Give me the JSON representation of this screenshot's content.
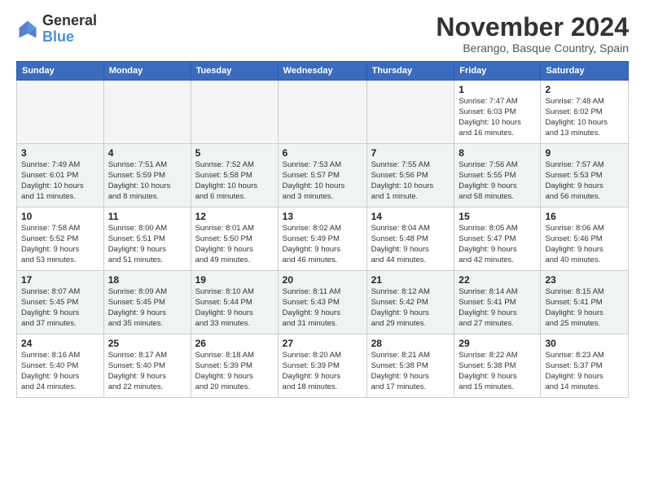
{
  "logo": {
    "line1": "General",
    "line2": "Blue"
  },
  "title": "November 2024",
  "location": "Berango, Basque Country, Spain",
  "weekdays": [
    "Sunday",
    "Monday",
    "Tuesday",
    "Wednesday",
    "Thursday",
    "Friday",
    "Saturday"
  ],
  "weeks": [
    [
      {
        "day": "",
        "info": ""
      },
      {
        "day": "",
        "info": ""
      },
      {
        "day": "",
        "info": ""
      },
      {
        "day": "",
        "info": ""
      },
      {
        "day": "",
        "info": ""
      },
      {
        "day": "1",
        "info": "Sunrise: 7:47 AM\nSunset: 6:03 PM\nDaylight: 10 hours\nand 16 minutes."
      },
      {
        "day": "2",
        "info": "Sunrise: 7:48 AM\nSunset: 6:02 PM\nDaylight: 10 hours\nand 13 minutes."
      }
    ],
    [
      {
        "day": "3",
        "info": "Sunrise: 7:49 AM\nSunset: 6:01 PM\nDaylight: 10 hours\nand 11 minutes."
      },
      {
        "day": "4",
        "info": "Sunrise: 7:51 AM\nSunset: 5:59 PM\nDaylight: 10 hours\nand 8 minutes."
      },
      {
        "day": "5",
        "info": "Sunrise: 7:52 AM\nSunset: 5:58 PM\nDaylight: 10 hours\nand 6 minutes."
      },
      {
        "day": "6",
        "info": "Sunrise: 7:53 AM\nSunset: 5:57 PM\nDaylight: 10 hours\nand 3 minutes."
      },
      {
        "day": "7",
        "info": "Sunrise: 7:55 AM\nSunset: 5:56 PM\nDaylight: 10 hours\nand 1 minute."
      },
      {
        "day": "8",
        "info": "Sunrise: 7:56 AM\nSunset: 5:55 PM\nDaylight: 9 hours\nand 58 minutes."
      },
      {
        "day": "9",
        "info": "Sunrise: 7:57 AM\nSunset: 5:53 PM\nDaylight: 9 hours\nand 56 minutes."
      }
    ],
    [
      {
        "day": "10",
        "info": "Sunrise: 7:58 AM\nSunset: 5:52 PM\nDaylight: 9 hours\nand 53 minutes."
      },
      {
        "day": "11",
        "info": "Sunrise: 8:00 AM\nSunset: 5:51 PM\nDaylight: 9 hours\nand 51 minutes."
      },
      {
        "day": "12",
        "info": "Sunrise: 8:01 AM\nSunset: 5:50 PM\nDaylight: 9 hours\nand 49 minutes."
      },
      {
        "day": "13",
        "info": "Sunrise: 8:02 AM\nSunset: 5:49 PM\nDaylight: 9 hours\nand 46 minutes."
      },
      {
        "day": "14",
        "info": "Sunrise: 8:04 AM\nSunset: 5:48 PM\nDaylight: 9 hours\nand 44 minutes."
      },
      {
        "day": "15",
        "info": "Sunrise: 8:05 AM\nSunset: 5:47 PM\nDaylight: 9 hours\nand 42 minutes."
      },
      {
        "day": "16",
        "info": "Sunrise: 8:06 AM\nSunset: 5:46 PM\nDaylight: 9 hours\nand 40 minutes."
      }
    ],
    [
      {
        "day": "17",
        "info": "Sunrise: 8:07 AM\nSunset: 5:45 PM\nDaylight: 9 hours\nand 37 minutes."
      },
      {
        "day": "18",
        "info": "Sunrise: 8:09 AM\nSunset: 5:45 PM\nDaylight: 9 hours\nand 35 minutes."
      },
      {
        "day": "19",
        "info": "Sunrise: 8:10 AM\nSunset: 5:44 PM\nDaylight: 9 hours\nand 33 minutes."
      },
      {
        "day": "20",
        "info": "Sunrise: 8:11 AM\nSunset: 5:43 PM\nDaylight: 9 hours\nand 31 minutes."
      },
      {
        "day": "21",
        "info": "Sunrise: 8:12 AM\nSunset: 5:42 PM\nDaylight: 9 hours\nand 29 minutes."
      },
      {
        "day": "22",
        "info": "Sunrise: 8:14 AM\nSunset: 5:41 PM\nDaylight: 9 hours\nand 27 minutes."
      },
      {
        "day": "23",
        "info": "Sunrise: 8:15 AM\nSunset: 5:41 PM\nDaylight: 9 hours\nand 25 minutes."
      }
    ],
    [
      {
        "day": "24",
        "info": "Sunrise: 8:16 AM\nSunset: 5:40 PM\nDaylight: 9 hours\nand 24 minutes."
      },
      {
        "day": "25",
        "info": "Sunrise: 8:17 AM\nSunset: 5:40 PM\nDaylight: 9 hours\nand 22 minutes."
      },
      {
        "day": "26",
        "info": "Sunrise: 8:18 AM\nSunset: 5:39 PM\nDaylight: 9 hours\nand 20 minutes."
      },
      {
        "day": "27",
        "info": "Sunrise: 8:20 AM\nSunset: 5:39 PM\nDaylight: 9 hours\nand 18 minutes."
      },
      {
        "day": "28",
        "info": "Sunrise: 8:21 AM\nSunset: 5:38 PM\nDaylight: 9 hours\nand 17 minutes."
      },
      {
        "day": "29",
        "info": "Sunrise: 8:22 AM\nSunset: 5:38 PM\nDaylight: 9 hours\nand 15 minutes."
      },
      {
        "day": "30",
        "info": "Sunrise: 8:23 AM\nSunset: 5:37 PM\nDaylight: 9 hours\nand 14 minutes."
      }
    ]
  ]
}
